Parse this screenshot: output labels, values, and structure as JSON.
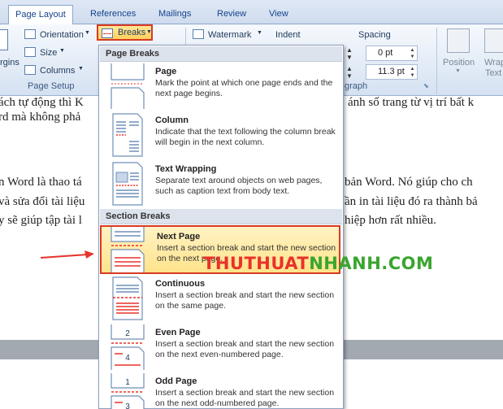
{
  "tabs": [
    "Page Layout",
    "References",
    "Mailings",
    "Review",
    "View"
  ],
  "ribbon": {
    "orientation": "Orientation",
    "size": "Size",
    "columns": "Columns",
    "margins_partial": "rgins",
    "page_setup_label": "Page Setup",
    "breaks": "Breaks",
    "watermark": "Watermark",
    "indent": "Indent",
    "spacing": "Spacing",
    "spacing_before": "0 pt",
    "spacing_after": "11.3 pt",
    "paragraph_partial": "graph",
    "position": "Position",
    "wrap_text_1": "Wrap",
    "wrap_text_2": "Text"
  },
  "document": {
    "line1_left": "ách tự động thì K",
    "line1_right": "ánh số trang từ vị trí bất k",
    "line2_left": "rd mà không phả",
    "line3_left": "n Word là thao tá",
    "line3_right": "bản Word. Nó giúp cho ch",
    "line4_left": "và sửa đổi tài liệu",
    "line4_right": "ần in tài liệu đó ra thành bả",
    "line5_left": "y sẽ giúp tập tài l",
    "line5_right": "hiệp hơn rất nhiều."
  },
  "menu": {
    "page_breaks_header": "Page Breaks",
    "section_breaks_header": "Section Breaks",
    "items": [
      {
        "title": "Page",
        "desc": "Mark the point at which one page ends and the next page begins."
      },
      {
        "title": "Column",
        "desc": "Indicate that the text following the column break will begin in the next column."
      },
      {
        "title": "Text Wrapping",
        "desc": "Separate text around objects on web pages, such as caption text from body text."
      },
      {
        "title": "Next Page",
        "desc": "Insert a section break and start the new section on the next page."
      },
      {
        "title": "Continuous",
        "desc": "Insert a section break and start the new section on the same page."
      },
      {
        "title": "Even Page",
        "desc": "Insert a section break and start the new section on the next even-numbered page."
      },
      {
        "title": "Odd Page",
        "desc": "Insert a section break and start the new section on the next odd-numbered page."
      }
    ]
  },
  "watermark_text": {
    "part1": "THUTHUAT",
    "part2": "NHANH",
    "part3": ".COM"
  },
  "colors": {
    "accent_red": "#d93a23",
    "highlight": "#ffe38c",
    "watermark_red": "#e8322a",
    "watermark_green": "#3aa52f"
  }
}
